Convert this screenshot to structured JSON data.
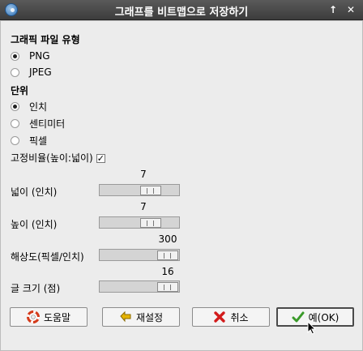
{
  "window": {
    "title": "그래프를 비트맵으로 저장하기",
    "up_button": "↑",
    "close_button": "✕"
  },
  "file_type": {
    "heading": "그래픽 파일 유형",
    "options": [
      "PNG",
      "JPEG"
    ],
    "selected": "PNG"
  },
  "unit": {
    "heading": "단위",
    "options": [
      "인치",
      "센티미터",
      "픽셀"
    ],
    "selected": "인치"
  },
  "aspect": {
    "label": "고정비율(높이:넓이)",
    "checked": true
  },
  "sliders": [
    {
      "label": "넓이 (인치)",
      "value": "7",
      "level": 0.7
    },
    {
      "label": "높이 (인치)",
      "value": "7",
      "level": 0.7
    },
    {
      "label": "해상도(픽셀/인치)",
      "value": "300",
      "level": 1.0
    },
    {
      "label": "글 크기 (점)",
      "value": "16",
      "level": 1.0
    }
  ],
  "buttons": {
    "help": "도움말",
    "reset": "재설정",
    "cancel": "취소",
    "ok": "예(OK)"
  },
  "icons": {
    "help": "lifebuoy-icon",
    "reset": "undo-arrow-icon",
    "cancel": "red-x-icon",
    "ok": "green-check-icon"
  },
  "colors": {
    "titlebar": "#4a4a4a",
    "background": "#ececec",
    "cancel_icon": "#d21b1b",
    "ok_icon": "#3a9a2a",
    "reset_icon": "#d9a300",
    "help_icon": "#d43a1a"
  }
}
